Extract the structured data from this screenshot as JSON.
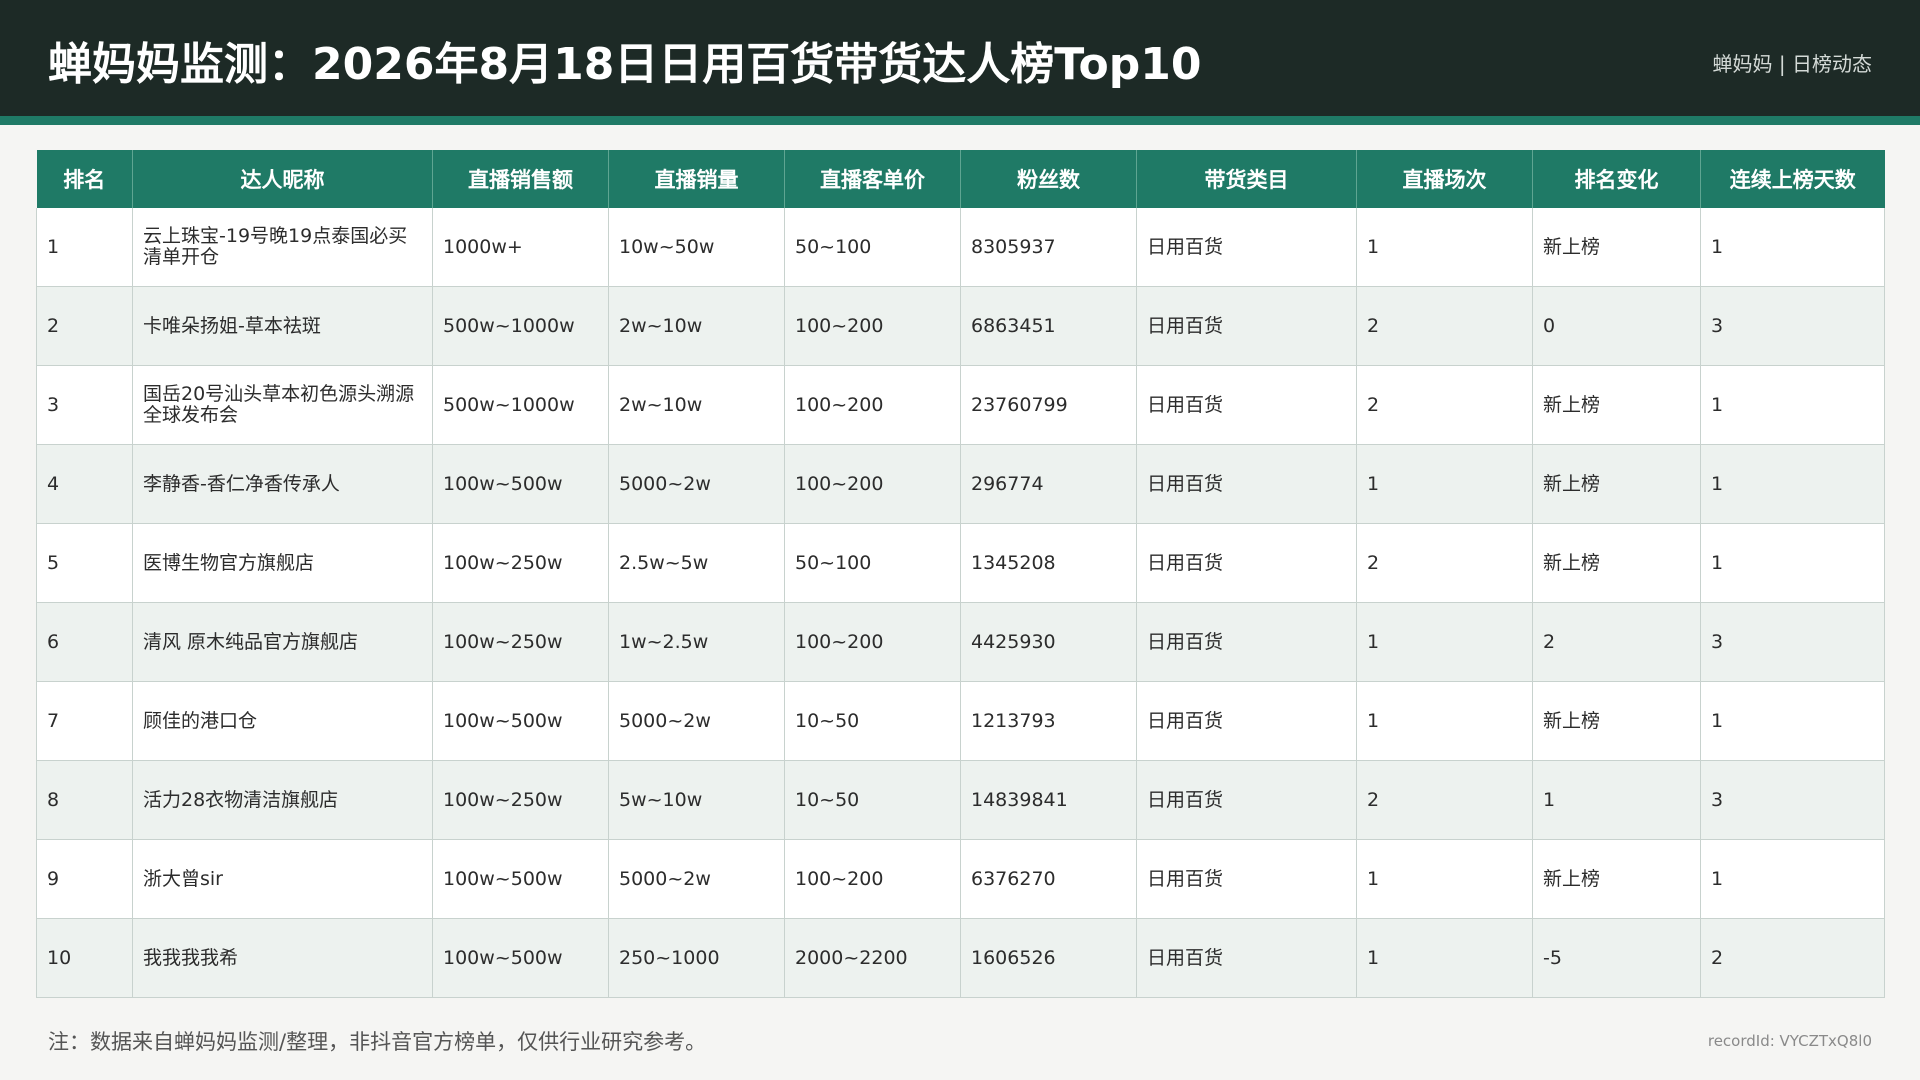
{
  "header": {
    "title": "蝉妈妈监测：2026年8月18日日用百货带货达人榜Top10",
    "brand": "蝉妈妈 | 日榜动态"
  },
  "table": {
    "columns": [
      "排名",
      "达人昵称",
      "直播销售额",
      "直播销量",
      "直播客单价",
      "粉丝数",
      "带货类目",
      "直播场次",
      "排名变化",
      "连续上榜天数"
    ],
    "rows": [
      [
        "1",
        "云上珠宝-19号晚19点泰国必买清单开仓",
        "1000w+",
        "10w~50w",
        "50~100",
        "8305937",
        "日用百货",
        "1",
        "新上榜",
        "1"
      ],
      [
        "2",
        "卡唯朵扬姐-草本祛斑",
        "500w~1000w",
        "2w~10w",
        "100~200",
        "6863451",
        "日用百货",
        "2",
        "0",
        "3"
      ],
      [
        "3",
        "国岳20号汕头草本初色源头溯源全球发布会",
        "500w~1000w",
        "2w~10w",
        "100~200",
        "23760799",
        "日用百货",
        "2",
        "新上榜",
        "1"
      ],
      [
        "4",
        "李静香-香仁净香传承人",
        "100w~500w",
        "5000~2w",
        "100~200",
        "296774",
        "日用百货",
        "1",
        "新上榜",
        "1"
      ],
      [
        "5",
        "医博生物官方旗舰店",
        "100w~250w",
        "2.5w~5w",
        "50~100",
        "1345208",
        "日用百货",
        "2",
        "新上榜",
        "1"
      ],
      [
        "6",
        "清风 原木纯品官方旗舰店",
        "100w~250w",
        "1w~2.5w",
        "100~200",
        "4425930",
        "日用百货",
        "1",
        "2",
        "3"
      ],
      [
        "7",
        "顾佳的港口仓",
        "100w~500w",
        "5000~2w",
        "10~50",
        "1213793",
        "日用百货",
        "1",
        "新上榜",
        "1"
      ],
      [
        "8",
        "活力28衣物清洁旗舰店",
        "100w~250w",
        "5w~10w",
        "10~50",
        "14839841",
        "日用百货",
        "2",
        "1",
        "3"
      ],
      [
        "9",
        "浙大曾sir",
        "100w~500w",
        "5000~2w",
        "100~200",
        "6376270",
        "日用百货",
        "1",
        "新上榜",
        "1"
      ],
      [
        "10",
        "我我我我希",
        "100w~500w",
        "250~1000",
        "2000~2200",
        "1606526",
        "日用百货",
        "1",
        "-5",
        "2"
      ]
    ]
  },
  "footer": {
    "note": "注：数据来自蝉妈妈监测/整理，非抖音官方榜单，仅供行业研究参考。",
    "record_id": "recordId: VYCZTxQ8l0"
  },
  "colors": {
    "header_bg": "#1d2a26",
    "accent": "#1f7a66",
    "row_alt": "#edf2ef"
  }
}
